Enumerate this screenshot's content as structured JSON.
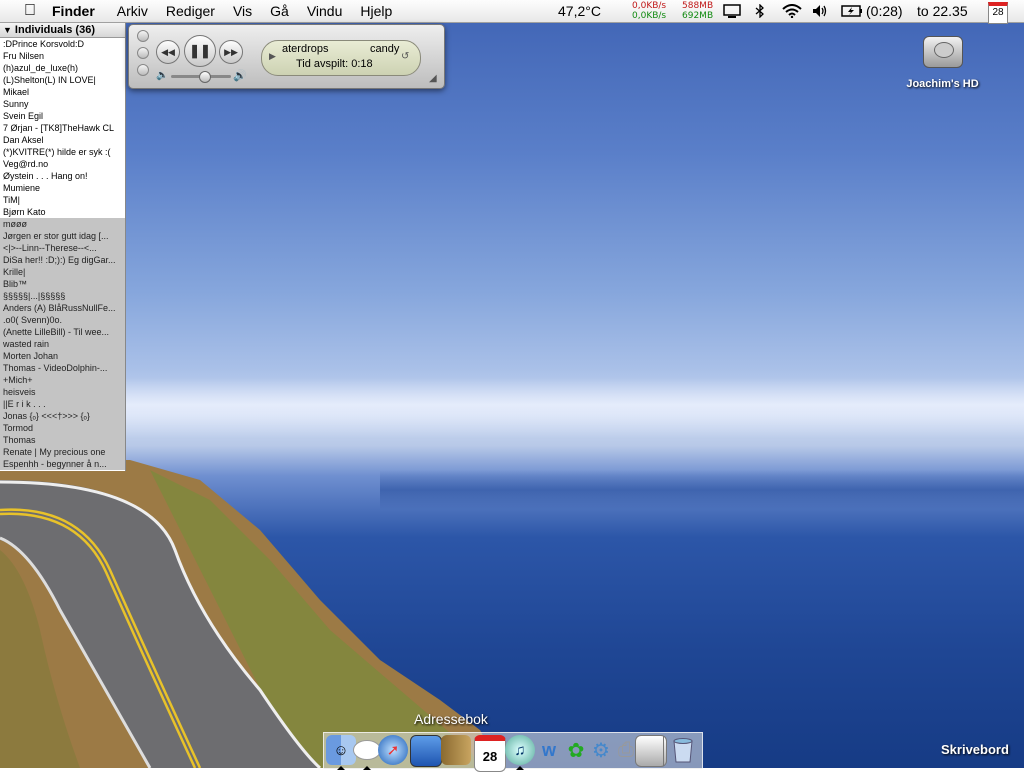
{
  "menubar": {
    "apple_icon": "apple-icon",
    "items": [
      "Finder",
      "Arkiv",
      "Rediger",
      "Vis",
      "Gå",
      "Vindu",
      "Hjelp"
    ],
    "temperature": "47,2°C",
    "net_up": "0,0KB/s",
    "net_down": "0,0KB/s",
    "mem_used": "588MB",
    "mem_free": "692MB",
    "battery_time": "(0:28)",
    "clock": "to 22.35",
    "calendar_day": "28"
  },
  "buddylist": {
    "group_label": "Individuals (36)",
    "online": [
      ":DPrince Korsvold:D",
      "Fru Nilsen",
      "(h)azul_de_luxe(h)",
      "(L)Shelton(L) IN LOVE|",
      "Mikael",
      "Sunny",
      "Svein Egil",
      "7 Ørjan - [TK8]TheHawk CL",
      "Dan Aksel",
      "(*)KVITRE(*) hilde er syk :(",
      "Veg@rd.no",
      "Øystein . . . Hang on!",
      "Mumiene",
      "TiM|",
      "Bjørn Kato"
    ],
    "idle": [
      "møøø",
      "Jørgen er stor gutt idag [...",
      "<|>--Linn--Therese--<...",
      "DiSa her!! :D;):) Eg digGar...",
      "Krille|",
      "Blib™",
      "§§§§§|...|§§§§§",
      "Anders (A) BlåRussNullFe...",
      ".o0( Svenn)0o.",
      "(Anette LilleBill) - Til wee...",
      "wasted rain",
      "Morten Johan",
      "Thomas - VideoDolphin-...",
      "+Mich+",
      "heisveis",
      "||E r i k . . .",
      "Jonas {ₒ} <<<†>>> {ₒ}",
      "Tormod",
      "Thomas",
      "Renate | My precious one",
      "Espenhh - begynner å n..."
    ]
  },
  "itunes": {
    "track": "aterdrops",
    "artist": "candy",
    "time_label": "Tid avspilt: 0:18",
    "volume": 0.55
  },
  "desktop": {
    "hd_label": "Joachim's HD",
    "desktop_label": "Skrivebord"
  },
  "dock": {
    "hover_label": "Adressebok",
    "icons": [
      "finder-icon",
      "ichat-icon",
      "safari-icon",
      "mail-icon",
      "address-book-icon",
      "ical-icon",
      "itunes-icon",
      "network-icon",
      "adium-icon",
      "system-prefs-icon",
      "printer-icon",
      "app-icon",
      "trash-icon"
    ],
    "ical_day": "28"
  }
}
